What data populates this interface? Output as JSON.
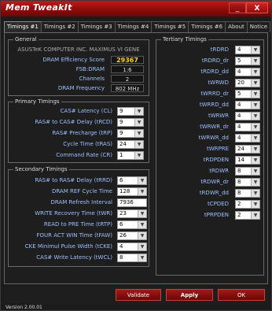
{
  "window": {
    "title": "Mem TweakIt",
    "min_label": "_",
    "close_label": "X"
  },
  "tabs": [
    {
      "label": "Timings #1"
    },
    {
      "label": "Timings #2"
    },
    {
      "label": "Timings #3"
    },
    {
      "label": "Timings #4"
    },
    {
      "label": "Timings #5"
    },
    {
      "label": "Timings #6"
    },
    {
      "label": "About"
    },
    {
      "label": "Notice"
    }
  ],
  "general": {
    "title": "General",
    "board": "ASUSTeK COMPUTER INC. MAXIMUS VI GENE",
    "rows": [
      {
        "label": "DRAM Efficiency Score",
        "value": "29367"
      },
      {
        "label": "FSB:DRAM",
        "value": "1:6"
      },
      {
        "label": "Channels",
        "value": "2"
      },
      {
        "label": "DRAM Frequency",
        "value": "802 MHz"
      }
    ]
  },
  "primary": {
    "title": "Primary Timings",
    "rows": [
      {
        "label": "CAS# Latency (CL)",
        "value": "9"
      },
      {
        "label": "RAS# to CAS# Delay (tRCD)",
        "value": "9"
      },
      {
        "label": "RAS# Precharge (tRP)",
        "value": "9"
      },
      {
        "label": "Cycle Time (tRAS)",
        "value": "24"
      },
      {
        "label": "Command Rate (CR)",
        "value": "1"
      }
    ]
  },
  "secondary": {
    "title": "Secondary Timings",
    "rows": [
      {
        "label": "RAS# to RAS# Delay (tRRD)",
        "value": "6"
      },
      {
        "label": "DRAM REF Cycle Time",
        "value": "128"
      },
      {
        "label": "DRAM Refresh Interval",
        "value": "7936"
      },
      {
        "label": "WRITE Recovery Time (tWR)",
        "value": "23"
      },
      {
        "label": "READ to PRE Time (tRTP)",
        "value": "6"
      },
      {
        "label": "FOUR ACT WIN Time (tFAW)",
        "value": "26"
      },
      {
        "label": "CKE Minimul Pulse Width (tCKE)",
        "value": "4"
      },
      {
        "label": "CAS# Write Latency (tWCL)",
        "value": "8"
      }
    ]
  },
  "tertiary": {
    "title": "Tertiary Timings",
    "rows": [
      {
        "label": "tRDRD",
        "value": "4"
      },
      {
        "label": "tRDRD_dr",
        "value": "5"
      },
      {
        "label": "tRDRD_dd",
        "value": "4"
      },
      {
        "label": "tWRWD",
        "value": "20"
      },
      {
        "label": "tWRRD_dr",
        "value": "5"
      },
      {
        "label": "tWRRD_dd",
        "value": "4"
      },
      {
        "label": "tWRWR",
        "value": "4"
      },
      {
        "label": "tWRWR_dr",
        "value": "4"
      },
      {
        "label": "tWRWR_dd",
        "value": "4"
      },
      {
        "label": "tWRPRE",
        "value": "24"
      },
      {
        "label": "tRDPDEN",
        "value": "14"
      },
      {
        "label": "tRDWR",
        "value": "8"
      },
      {
        "label": "tRDWR_dr",
        "value": "8"
      },
      {
        "label": "tRDWR_dd",
        "value": "8"
      },
      {
        "label": "tCPDED",
        "value": "2"
      },
      {
        "label": "tPRPDEN",
        "value": "2"
      }
    ]
  },
  "buttons": {
    "validate": "Validate",
    "apply": "Apply",
    "ok": "OK"
  },
  "version": "Version 2.00.01"
}
